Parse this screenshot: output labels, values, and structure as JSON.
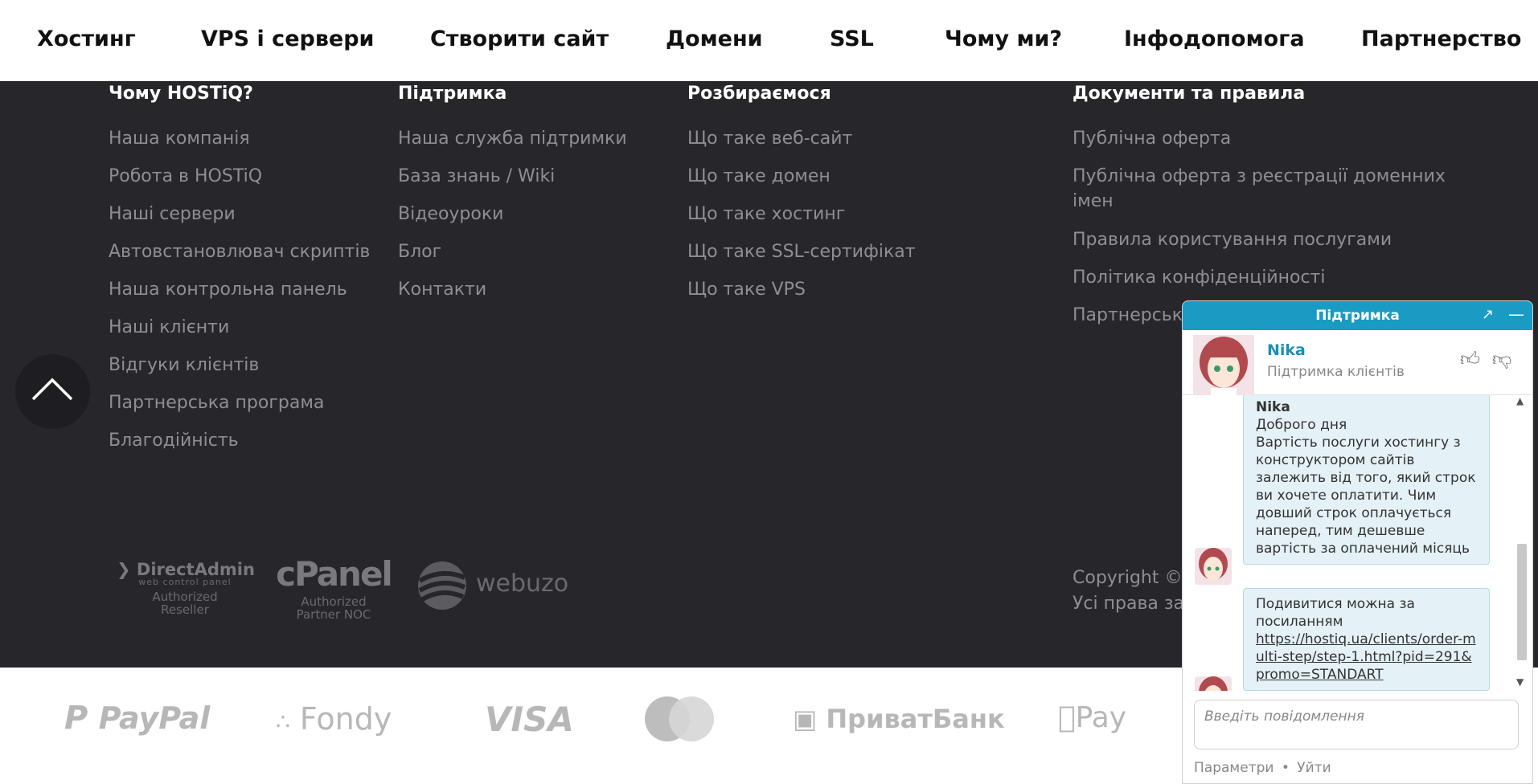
{
  "nav": {
    "items": [
      {
        "label": "Хостинг"
      },
      {
        "label": "VPS і сервери"
      },
      {
        "label": "Створити сайт"
      },
      {
        "label": "Домени"
      },
      {
        "label": "SSL"
      },
      {
        "label": "Чому ми?"
      },
      {
        "label": "Інфодопомога"
      },
      {
        "label": "Партнерство"
      }
    ]
  },
  "footer": {
    "columns": [
      {
        "title": "Чому HOSTiQ?",
        "links": [
          "Наша компанія",
          "Робота в HOSTiQ",
          "Наші сервери",
          "Автовстановлювач скриптів",
          "Наша контрольна панель",
          "Наші клієнти",
          "Відгуки клієнтів",
          "Партнерська програма",
          "Благодійність"
        ]
      },
      {
        "title": "Підтримка",
        "links": [
          "Наша служба підтримки",
          "База знань / Wiki",
          "Відеоуроки",
          "Блог",
          "Контакти"
        ]
      },
      {
        "title": "Розбираємося",
        "links": [
          "Що таке веб-сайт",
          "Що таке домен",
          "Що таке хостинг",
          "Що таке SSL-сертифікат",
          "Що таке VPS"
        ]
      },
      {
        "title": "Документи та правила",
        "links": [
          "Публічна оферта",
          "Публічна оферта з реєстрації доменних імен",
          "Правила користування послугами",
          "Політика конфіденційності",
          "Партнерськ"
        ]
      }
    ],
    "partner_logos": {
      "directadmin": {
        "name": "DirectAdmin",
        "sub": "web control panel",
        "caption": "Authorized Reseller"
      },
      "cpanel": {
        "name": "cPanel",
        "caption": "Authorized Partner NOC"
      },
      "webuzo": {
        "name": "webuzo"
      }
    },
    "copyright": {
      "line1": "Copyright ©",
      "line2": "Усі права за"
    }
  },
  "payments": [
    "PayPal",
    "Fondy",
    "VISA",
    "ПриватБанк",
    "Pay"
  ],
  "chat": {
    "header_title": "Підтримка",
    "agent_name": "Nika",
    "agent_role": "Підтримка клієнтів",
    "messages": [
      {
        "sender": "Nika",
        "lines": [
          "Доброго дня",
          "Вартість послуги хостингу з конструктором сайтів залежить від того, який строк ви хочете оплатити. Чим довший строк оплачується наперед, тим дешевше вартість за оплачений місяць"
        ]
      },
      {
        "text": "Подивитися можна за посиланням",
        "link": "https://hostiq.ua/clients/order-multi-step/step-1.html?pid=291&promo=STANDART"
      }
    ],
    "input_placeholder": "Введіть повідомлення",
    "footer_settings": "Параметри",
    "footer_sep": "•",
    "footer_leave": "Уйти",
    "colors": {
      "header": "#1a9bc4",
      "bubble": "#e4f1f7",
      "accent_name": "#1a8fb8"
    }
  },
  "colors": {
    "footer_bg": "#27272b",
    "link": "#8e8e93",
    "heading": "#ffffff"
  }
}
